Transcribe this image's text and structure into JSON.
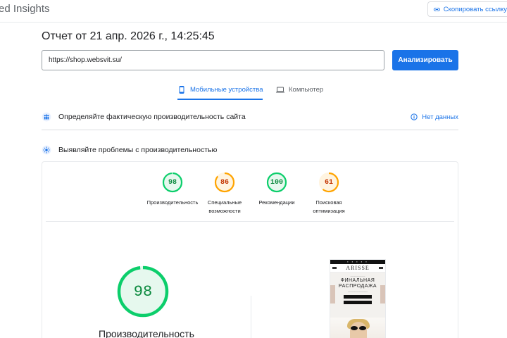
{
  "header": {
    "app_title": "ed Insights",
    "copy_link_label": "Скопировать ссылку"
  },
  "report": {
    "title": "Отчет от 21 апр. 2026 г., 14:25:45",
    "url_value": "https://shop.websvit.su/",
    "analyze_label": "Анализировать"
  },
  "tabs": [
    {
      "label": "Мобильные устройства",
      "active": true,
      "icon": "smartphone-icon"
    },
    {
      "label": "Компьютер",
      "active": false,
      "icon": "laptop-icon"
    }
  ],
  "sections": {
    "field_data": {
      "label": "Определяйте фактическую производительность сайта",
      "status": "Нет данных",
      "icon": "users-icon",
      "status_icon": "info-icon"
    },
    "diagnostics": {
      "label": "Выявляйте проблемы с производительностью",
      "icon": "lab-flask-icon"
    }
  },
  "scores": [
    {
      "value": 98,
      "label_line1": "Производительность",
      "label_line2": "",
      "color": "#0cce6b",
      "text_color": "#0c8a3f"
    },
    {
      "value": 86,
      "label_line1": "Специальные",
      "label_line2": "возможности",
      "color": "#ffa400",
      "text_color": "#c33300"
    },
    {
      "value": 100,
      "label_line1": "Рекомендации",
      "label_line2": "",
      "color": "#0cce6b",
      "text_color": "#0c8a3f"
    },
    {
      "value": 61,
      "label_line1": "Поисковая",
      "label_line2": "оптимизация",
      "color": "#ffa400",
      "text_color": "#c33300"
    }
  ],
  "main_score": {
    "value": 98,
    "label": "Производительность",
    "color": "#0cce6b"
  },
  "screenshot": {
    "brand": "ARISSE",
    "sale_line1": "ФИНАЛЬНАЯ",
    "sale_line2": "РАСПРОДАЖА"
  }
}
